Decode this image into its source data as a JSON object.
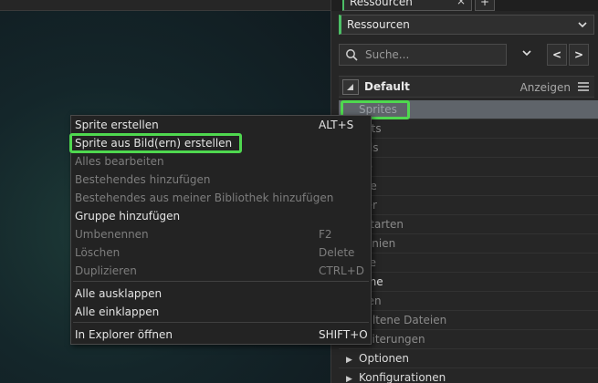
{
  "tab": {
    "label": "Ressourcen",
    "close": "×",
    "add": "+"
  },
  "resource_select": {
    "value": "Ressourcen",
    "chevron": "chevron-down-icon"
  },
  "search": {
    "placeholder": "Suche...",
    "icon": "search-icon"
  },
  "nav": {
    "prev": "<",
    "next": ">"
  },
  "group_header": {
    "title": "Default",
    "show_label": "Anzeigen"
  },
  "tree": {
    "items": [
      {
        "label": "Sprites",
        "selected": true
      },
      {
        "label": "Tile Sets"
      },
      {
        "label": "Sounds"
      },
      {
        "label": "Pfade"
      },
      {
        "label": "Skripte"
      },
      {
        "label": "Shader"
      },
      {
        "label": "Schriftarten"
      },
      {
        "label": "Zeitlinien"
      },
      {
        "label": "Objekte"
      },
      {
        "label": "Räume"
      },
      {
        "label": "Notizen"
      },
      {
        "label": "Enthaltene Dateien"
      },
      {
        "label": "Erweiterungen"
      },
      {
        "label": "Optionen",
        "expandable": true
      },
      {
        "label": "Konfigurationen",
        "expandable": true
      }
    ],
    "visible_labels": [
      "Sprites",
      "sets",
      "nds",
      "de",
      "pte",
      "der",
      "riftarten",
      "dlinien",
      "kte",
      "ume",
      "izen",
      "haltene Dateien",
      "veiterungen",
      "Optionen",
      "Konfigurationen"
    ]
  },
  "context_menu": {
    "items": [
      {
        "label": "Sprite erstellen",
        "shortcut": "ALT+S",
        "enabled": true
      },
      {
        "label": "Sprite aus Bild(ern) erstellen",
        "shortcut": "",
        "enabled": true
      },
      {
        "label": "Alles bearbeiten",
        "shortcut": "",
        "enabled": false
      },
      {
        "label": "Bestehendes hinzufügen",
        "shortcut": "",
        "enabled": false
      },
      {
        "label": "Bestehendes aus meiner Bibliothek hinzufügen",
        "shortcut": "",
        "enabled": false
      },
      {
        "label": "Gruppe hinzufügen",
        "shortcut": "",
        "enabled": true
      },
      {
        "label": "Umbenennen",
        "shortcut": "F2",
        "enabled": false
      },
      {
        "label": "Löschen",
        "shortcut": "Delete",
        "enabled": false
      },
      {
        "label": "Duplizieren",
        "shortcut": "CTRL+D",
        "enabled": false
      },
      {
        "label": "Alle ausklappen",
        "shortcut": "",
        "enabled": true
      },
      {
        "label": "Alle einklappen",
        "shortcut": "",
        "enabled": true
      },
      {
        "label": "In Explorer öffnen",
        "shortcut": "SHIFT+O",
        "enabled": true
      }
    ]
  },
  "colors": {
    "accent": "#4cbf66",
    "highlight": "#4fd84f",
    "panel": "#262626"
  }
}
